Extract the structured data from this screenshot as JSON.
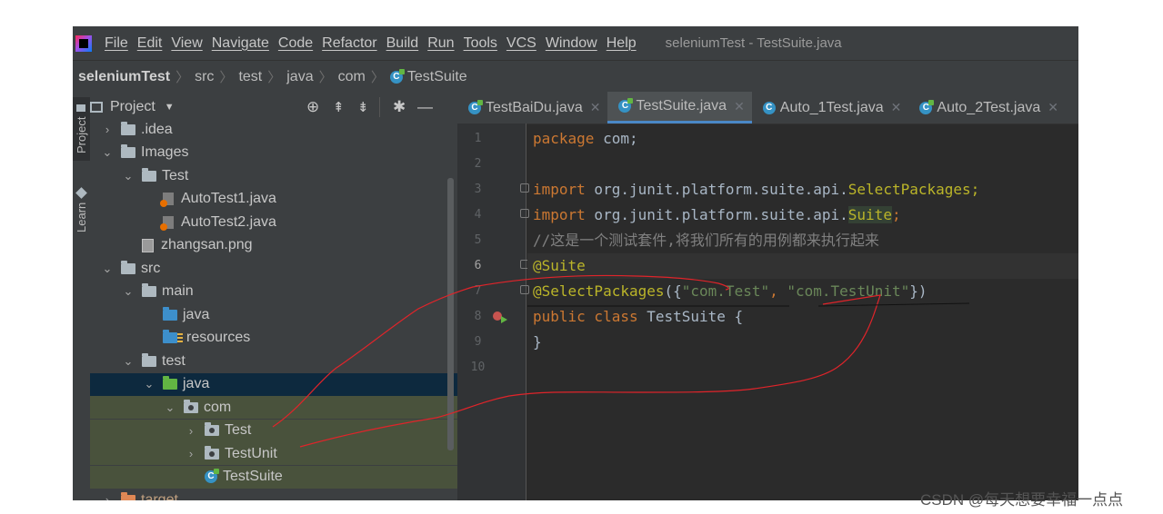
{
  "menu": {
    "items": [
      "File",
      "Edit",
      "View",
      "Navigate",
      "Code",
      "Refactor",
      "Build",
      "Run",
      "Tools",
      "VCS",
      "Window",
      "Help"
    ],
    "window_title": "seleniumTest - TestSuite.java"
  },
  "breadcrumb": {
    "project": "seleniumTest",
    "parts": [
      "src",
      "test",
      "java",
      "com"
    ],
    "file": "TestSuite"
  },
  "toolstrip": {
    "project_tab": "Project",
    "learn_tab": "Learn"
  },
  "project_panel": {
    "title": "Project",
    "tree": [
      {
        "label": ".idea",
        "arrow": ">",
        "icon": "folder-icon",
        "indent": 0
      },
      {
        "label": "Images",
        "arrow": "v",
        "icon": "folder-icon",
        "indent": 0
      },
      {
        "label": "Test",
        "arrow": "v",
        "icon": "folder-icon",
        "indent": 1
      },
      {
        "label": "AutoTest1.java",
        "arrow": "",
        "icon": "java-file-icon",
        "indent": 2
      },
      {
        "label": "AutoTest2.java",
        "arrow": "",
        "icon": "java-file-icon",
        "indent": 2
      },
      {
        "label": "zhangsan.png",
        "arrow": "",
        "icon": "image-file-icon",
        "indent": 1
      },
      {
        "label": "src",
        "arrow": "v",
        "icon": "folder-icon",
        "indent": 0
      },
      {
        "label": "main",
        "arrow": "v",
        "icon": "folder-icon",
        "indent": 1
      },
      {
        "label": "java",
        "arrow": "",
        "icon": "source-folder-icon",
        "indent": 2
      },
      {
        "label": "resources",
        "arrow": "",
        "icon": "resources-folder-icon",
        "indent": 2
      },
      {
        "label": "test",
        "arrow": "v",
        "icon": "folder-icon",
        "indent": 1
      },
      {
        "label": "java",
        "arrow": "v",
        "icon": "test-source-folder-icon",
        "indent": 2
      },
      {
        "label": "com",
        "arrow": "v",
        "icon": "package-icon",
        "indent": 3
      },
      {
        "label": "Test",
        "arrow": ">",
        "icon": "package-icon",
        "indent": 4
      },
      {
        "label": "TestUnit",
        "arrow": ">",
        "icon": "package-icon",
        "indent": 4
      },
      {
        "label": "TestSuite",
        "arrow": "",
        "icon": "class-icon",
        "indent": 4
      },
      {
        "label": "target",
        "arrow": ">",
        "icon": "excluded-folder-icon",
        "indent": 0
      }
    ]
  },
  "editor": {
    "tabs": [
      {
        "label": "TestBaiDu.java",
        "active": false
      },
      {
        "label": "TestSuite.java",
        "active": true
      },
      {
        "label": "Auto_1Test.java",
        "active": false
      },
      {
        "label": "Auto_2Test.java",
        "active": false
      }
    ],
    "line_numbers": [
      "1",
      "2",
      "3",
      "4",
      "5",
      "6",
      "7",
      "8",
      "9",
      "10"
    ],
    "current_line": "6",
    "code": {
      "l1_kw": "package",
      "l1_rest": " com;",
      "l3_kw": "import",
      "l3_rest": " org.junit.platform.suite.api.",
      "l3_ann": "SelectPackages;",
      "l4_kw": "import",
      "l4_rest": " org.junit.platform.suite.api.",
      "l4_ann": "Suite",
      "l4_end": ";",
      "l5_comment": "//这是一个测试套件,将我们所有的用例都来执行起来",
      "l6_ann": "@Suite",
      "l7_ann": "@SelectPackages",
      "l7_open": "({",
      "l7_str1": "\"com.Test\"",
      "l7_comma": ",",
      "l7_str2": "\"com.TestUnit\"",
      "l7_close": "})",
      "l8_kw": "public class",
      "l8_rest": " TestSuite {",
      "l9": "}"
    }
  },
  "watermark": "CSDN @每天想要幸福一点点",
  "colors": {
    "annotation_line": "#e0242a",
    "accent": "#4a88c7"
  }
}
